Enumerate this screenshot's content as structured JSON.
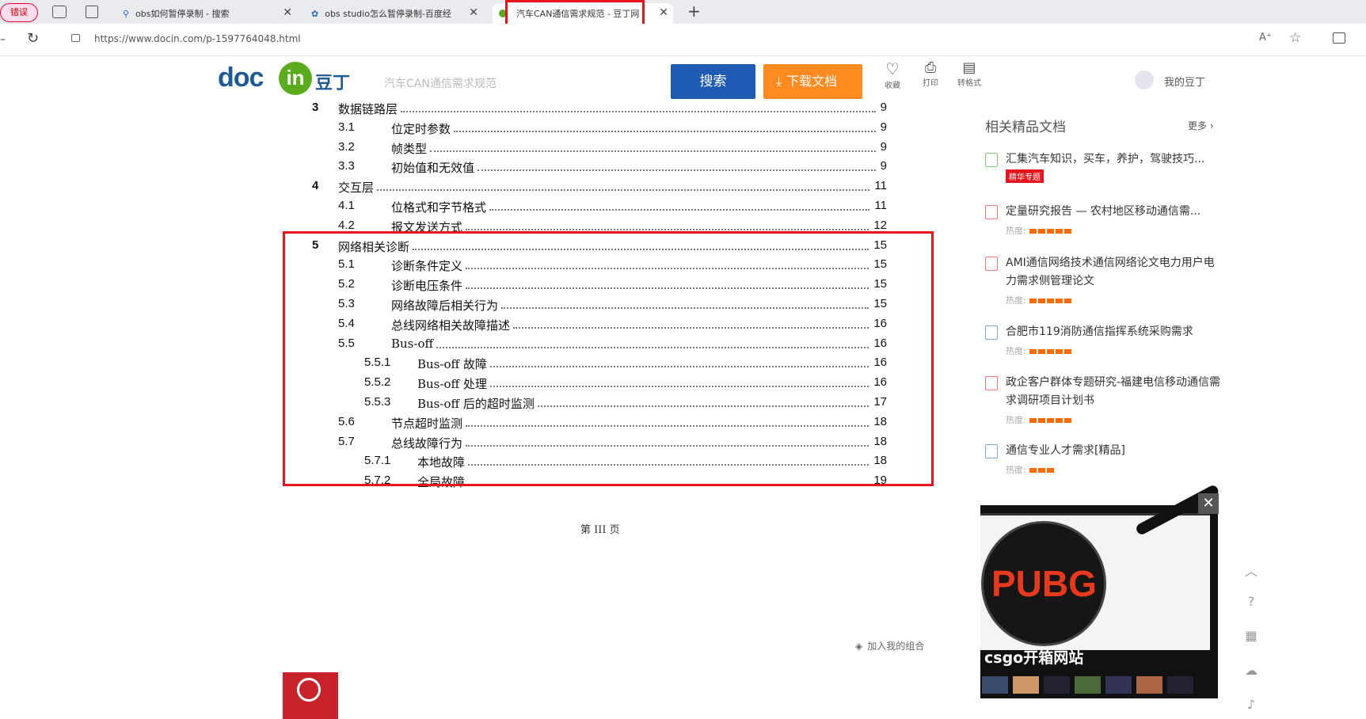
{
  "browser": {
    "tabs": [
      {
        "label": "错误",
        "active": false
      },
      {
        "label": "obs如何暂停录制 - 搜索",
        "active": false
      },
      {
        "label": "obs studio怎么暂停录制-百度经",
        "active": false
      },
      {
        "label": "汽车CAN通信需求规范 - 豆丁网",
        "active": true
      }
    ],
    "new_tab": "+",
    "url": "https://www.docin.com/p-1597764048.html"
  },
  "header": {
    "logo_doc": "doc",
    "logo_in": "in",
    "logo_cn": "豆丁",
    "search_placeholder": "汽车CAN通信需求规范",
    "search_button": "搜索",
    "download_button": "下载文档",
    "tools": [
      {
        "label": "收藏",
        "icon": "heart-icon"
      },
      {
        "label": "打印",
        "icon": "printer-icon"
      },
      {
        "label": "转格式",
        "icon": "convert-icon"
      }
    ],
    "user_label": "我的豆丁"
  },
  "toc": [
    {
      "num": "3",
      "title": "数据链路层",
      "page": "9",
      "level": 1
    },
    {
      "num": "3.1",
      "title": "位定时参数",
      "page": "9",
      "level": 2
    },
    {
      "num": "3.2",
      "title": "帧类型",
      "page": "9",
      "level": 2
    },
    {
      "num": "3.3",
      "title": "初始值和无效值",
      "page": "9",
      "level": 2
    },
    {
      "num": "4",
      "title": "交互层",
      "page": "11",
      "level": 1
    },
    {
      "num": "4.1",
      "title": "位格式和字节格式",
      "page": "11",
      "level": 2
    },
    {
      "num": "4.2",
      "title": "报文发送方式",
      "page": "12",
      "level": 2
    },
    {
      "num": "5",
      "title": "网络相关诊断",
      "page": "15",
      "level": 1
    },
    {
      "num": "5.1",
      "title": "诊断条件定义",
      "page": "15",
      "level": 2
    },
    {
      "num": "5.2",
      "title": "诊断电压条件",
      "page": "15",
      "level": 2
    },
    {
      "num": "5.3",
      "title": "网络故障后相关行为",
      "page": "15",
      "level": 2
    },
    {
      "num": "5.4",
      "title": "总线网络相关故障描述",
      "page": "16",
      "level": 2
    },
    {
      "num": "5.5",
      "title": "Bus-off",
      "page": "16",
      "level": 2
    },
    {
      "num": "5.5.1",
      "title": "Bus-off 故障",
      "page": "16",
      "level": 3
    },
    {
      "num": "5.5.2",
      "title": "Bus-off 处理",
      "page": "16",
      "level": 3
    },
    {
      "num": "5.5.3",
      "title": "Bus-off 后的超时监测",
      "page": "17",
      "level": 3
    },
    {
      "num": "5.6",
      "title": "节点超时监测",
      "page": "18",
      "level": 2
    },
    {
      "num": "5.7",
      "title": "总线故障行为",
      "page": "18",
      "level": 2
    },
    {
      "num": "5.7.1",
      "title": "本地故障",
      "page": "18",
      "level": 3
    },
    {
      "num": "5.7.2",
      "title": "全局故障",
      "page": "19",
      "level": 3
    }
  ],
  "page_footer": "第 III 页",
  "add_to_collection": "加入我的组合",
  "related": {
    "heading": "相关精品文档",
    "more": "更多",
    "heat_label": "热度:",
    "items": [
      {
        "title": "汇集汽车知识，买车，养护，驾驶技巧...",
        "badge": "精华专题",
        "heat": 0
      },
      {
        "title": "定量研究报告 — 农村地区移动通信需...",
        "badge": "",
        "heat": 5
      },
      {
        "title": "AMI通信网络技术通信网络论文电力用户电力需求侧管理论文",
        "badge": "",
        "heat": 5
      },
      {
        "title": "合肥市119消防通信指挥系统采购需求",
        "badge": "",
        "heat": 5
      },
      {
        "title": "政企客户群体专题研究-福建电信移动通信需求调研项目计划书",
        "badge": "",
        "heat": 5
      },
      {
        "title": "通信专业人才需求[精品]",
        "badge": "",
        "heat": 3
      }
    ]
  },
  "ad": {
    "logo_text": "PUBG",
    "caption": "csgo开箱网站",
    "close": "✕"
  },
  "colors": {
    "search_blue": "#1f5bb5",
    "download_orange": "#ff8a1f",
    "highlight_red": "#e8141b",
    "logo_green": "#5aab1e"
  }
}
